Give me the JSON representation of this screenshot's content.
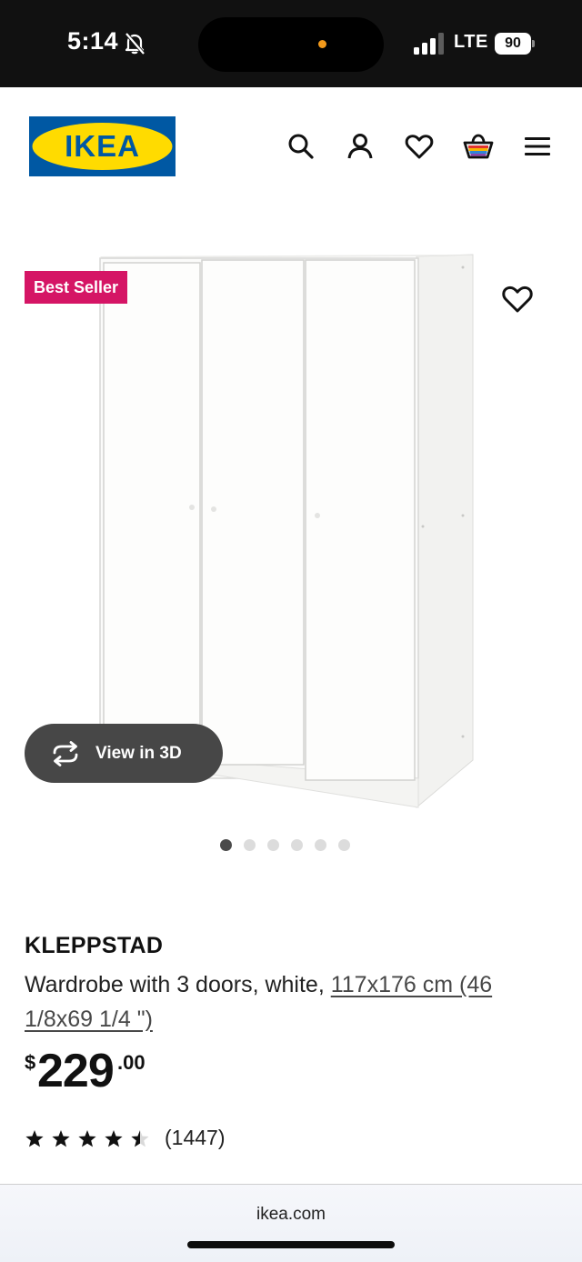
{
  "status_bar": {
    "time": "5:14",
    "network": "LTE",
    "battery": "90",
    "icons": [
      "bell-muted-icon",
      "signal-icon",
      "battery-icon"
    ]
  },
  "header": {
    "logo_text": "IKEA",
    "icons": [
      "search-icon",
      "user-icon",
      "heart-icon",
      "cart-icon",
      "menu-icon"
    ]
  },
  "product": {
    "badge": "Best Seller",
    "view_3d_label": "View in 3D",
    "image_count": 6,
    "active_image": 1,
    "name": "KLEPPSTAD",
    "description": "Wardrobe with 3 doors, white, ",
    "dimensions": "117x176 cm (46 1/8x69 1/4 \")",
    "price": {
      "currency": "$",
      "integer": "229",
      "decimal": ".00"
    },
    "rating": 4.5,
    "review_count": "(1447)"
  },
  "browser": {
    "url": "ikea.com"
  },
  "colors": {
    "ikea_blue": "#0058a3",
    "ikea_yellow": "#ffdb00",
    "badge_red": "#d51565",
    "button_gray": "#474747"
  }
}
